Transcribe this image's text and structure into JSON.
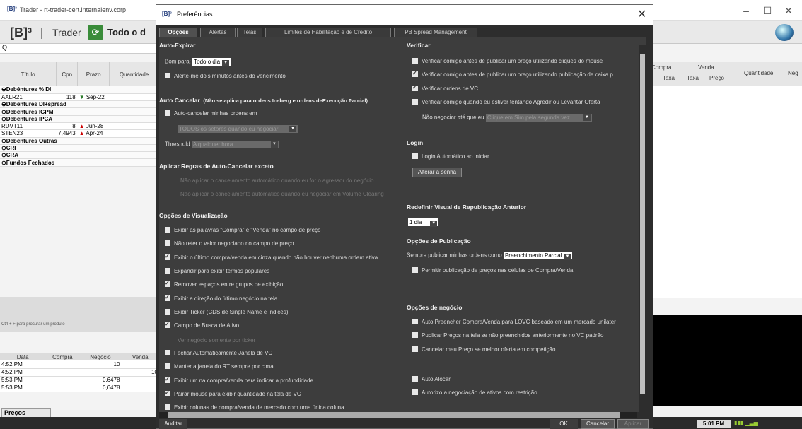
{
  "bg": {
    "window_title": "Trader - rt-trader-cert.internalenv.corp",
    "logo": "[B]³",
    "app_name": "Trader",
    "tab_label": "Todo o d",
    "search_placeholder": "Q",
    "left_headers": [
      "Título",
      "Cpn",
      "Prazo",
      "Quantidade"
    ],
    "left_rows": [
      {
        "type": "group",
        "label": "Debêntures % DI"
      },
      {
        "type": "row",
        "titulo": "AALR21",
        "cpn": "118",
        "dir": "down",
        "prazo": "Sep-22"
      },
      {
        "type": "group",
        "label": "Debêntures DI+spread"
      },
      {
        "type": "group",
        "label": "Debêntures IGPM"
      },
      {
        "type": "group",
        "label": "Debêntures IPCA"
      },
      {
        "type": "row",
        "titulo": "RDVT11",
        "cpn": "8",
        "dir": "up",
        "prazo": "Jun-28"
      },
      {
        "type": "row",
        "titulo": "STEN23",
        "cpn": "7,4943",
        "dir": "up",
        "prazo": "Apr-24"
      },
      {
        "type": "group",
        "label": "Debêntures Outras"
      },
      {
        "type": "group",
        "label": "CRI"
      },
      {
        "type": "group",
        "label": "CRA"
      },
      {
        "type": "group",
        "label": "Fundos Fechados"
      }
    ],
    "right_headers": {
      "compra": "Compra",
      "venda": "Venda",
      "taxa1": "Taxa",
      "taxa2": "Taxa",
      "preco": "Preço",
      "quantidade": "Quantidade",
      "neg": "Neg"
    },
    "hint": "Ctrl + F para procurar um produto",
    "bottom_headers": [
      "Data",
      "Compra",
      "Negócio",
      "Venda"
    ],
    "bottom_rows": [
      {
        "data": "4:52 PM",
        "compra": "",
        "negocio": "10",
        "venda": ""
      },
      {
        "data": "4:52 PM",
        "compra": "",
        "negocio": "",
        "venda": "10"
      },
      {
        "data": "5:53 PM",
        "compra": "",
        "negocio": "0,6478",
        "venda": ""
      },
      {
        "data": "5:53 PM",
        "compra": "",
        "negocio": "0,6478",
        "venda": ""
      }
    ],
    "hist_button": "Preços históricos",
    "clock": "5:01 PM"
  },
  "dialog": {
    "logo": "[B]³",
    "title": "Preferências",
    "tabs": [
      "Opções",
      "Alertas",
      "Telas",
      "Limites de Habilitação e de Crédito",
      "PB Spread Management"
    ],
    "left": {
      "auto_expirar": "Auto-Expirar",
      "bom_para_label": "Bom para:",
      "bom_para_value": "Todo o dia",
      "alerte": "Alerte-me dois minutos antes do vencimento",
      "auto_cancelar": "Auto Cancelar",
      "auto_cancelar_note": "(Não se aplica para ordens Iceberg e ordens deExecução Parcial)",
      "auto_cancelar_cb": "Auto-cancelar minhas ordens em",
      "setores_value": "TODOS os setores quando eu negociar",
      "threshold_label": "Threshold",
      "threshold_value": "A qualquer hora",
      "aplicar_regras": "Aplicar Regras de Auto-Cancelar exceto",
      "nao_aplicar1": "Não aplicar o cancelamento automático quando eu for o agressor do negócio",
      "nao_aplicar2": "Não aplicar o cancelamento automático quando eu negociar em Volume Clearing",
      "opcoes_vis": "Opções de Visualização",
      "vis_items": [
        {
          "label": "Exibir as palavras \"Compra\" e \"Venda\" no campo de preço",
          "checked": false
        },
        {
          "label": "Não reter o valor negociado no campo de preço",
          "checked": false
        },
        {
          "label": "Exibir o último compra/venda em cinza quando não houver nenhuma ordem ativa",
          "checked": true
        },
        {
          "label": "Expandir para exibir termos populares",
          "checked": false
        },
        {
          "label": "Remover espaços entre grupos de exibição",
          "checked": true
        },
        {
          "label": "Exibir a direção do último negócio na tela",
          "checked": true
        },
        {
          "label": "Exibir Ticker (CDS de Single Name e índices)",
          "checked": false
        },
        {
          "label": "Campo de Busca de Ativo",
          "checked": true
        }
      ],
      "ver_negocio": "Ver negócio somente por ticker",
      "vis_items2": [
        {
          "label": "Fechar Automaticamente Janela de VC",
          "checked": false
        },
        {
          "label": "Manter a janela do RT sempre por cima",
          "checked": false
        },
        {
          "label": "Exibir um  na compra/venda para indicar a profundidade",
          "checked": true
        },
        {
          "label": "Pairar mouse para exibir quantidade na tela de VC",
          "checked": true
        },
        {
          "label": "Exibir colunas de compra/venda de mercado com uma única coluna",
          "checked": false
        }
      ]
    },
    "right": {
      "verificar": "Verificar",
      "ver_items": [
        {
          "label": "Verificar comigo antes de publicar um preço utilizando cliques do mouse",
          "checked": false
        },
        {
          "label": "Verificar comigo antes de publicar um preço utilizando publicação de caixa p",
          "checked": true
        },
        {
          "label": "Verificar ordens de VC",
          "checked": true
        },
        {
          "label": "Verificar comigo quando eu estiver tentando Agredir ou Levantar Oferta",
          "checked": false
        }
      ],
      "nao_negociar_label": "Não negociar até que eu",
      "nao_negociar_value": "Clique em Sim pela segunda vez",
      "login": "Login",
      "login_auto": "Login Automático ao iniciar",
      "alterar_senha": "Alterar a senha",
      "redefinir": "Redefinir  Visual de Republicação Anterior",
      "redefinir_value": "1 dia",
      "opcoes_pub": "Opções de Publicação",
      "sempre_publicar_label": "Sempre publicar minhas ordens como",
      "sempre_publicar_value": "Preenchimento Parcial",
      "permitir": "Permitir publicação de preços nas células de Compra/Venda",
      "opcoes_neg": "Opções de negócio",
      "neg_items": [
        {
          "label": "Auto Preencher Compra/Venda para LOVC baseado em um mercado unilater",
          "checked": false
        },
        {
          "label": "Publicar Preços na tela se não preenchidos anteriormente no VC padrão",
          "checked": false
        },
        {
          "label": "Cancelar meu Preço se melhor oferta em competição",
          "checked": false
        }
      ],
      "auto_alocar": "Auto Alocar",
      "autorizo": "Autorizo a negociação de ativos com restrição"
    },
    "footer": {
      "auditar": "Auditar",
      "ok": "OK",
      "cancelar": "Cancelar",
      "aplicar": "Aplicar"
    }
  }
}
